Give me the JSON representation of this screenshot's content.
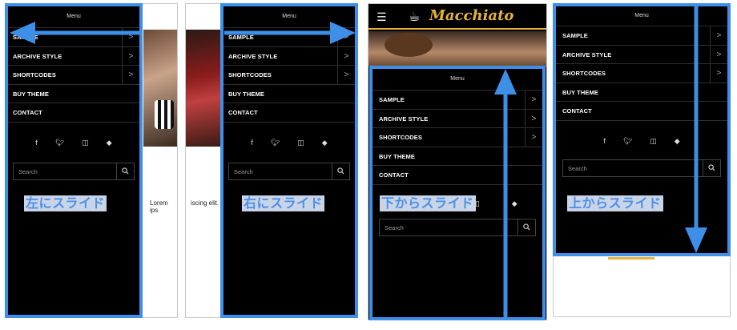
{
  "menu": {
    "title": "Menu",
    "items": [
      {
        "label": "SAMPLE",
        "has_sub": true
      },
      {
        "label": "ARCHIVE STYLE",
        "has_sub": true
      },
      {
        "label": "SHORTCODES",
        "has_sub": true
      },
      {
        "label": "BUY THEME",
        "has_sub": false
      },
      {
        "label": "CONTACT",
        "has_sub": false
      }
    ],
    "submenu_glyph": ">",
    "social_icons": [
      "facebook-icon",
      "twitter-icon",
      "instagram-icon",
      "feedly-icon"
    ],
    "search_placeholder": "Search"
  },
  "panels": {
    "left_slide": {
      "label": "左にスライド"
    },
    "right_slide": {
      "label": "右にスライド"
    },
    "bottom_slide": {
      "label": "下からスライド"
    },
    "top_slide": {
      "label": "上からスライド"
    }
  },
  "site": {
    "logo": "Macchiato",
    "lorem_left": "Lorem ips",
    "lorem_right": "iscing elit."
  },
  "colors": {
    "accent_blue": "#3d8fe8",
    "menu_bg": "#000000",
    "label_bg": "#c9d5e6",
    "logo_gold": "#e6b43c"
  }
}
